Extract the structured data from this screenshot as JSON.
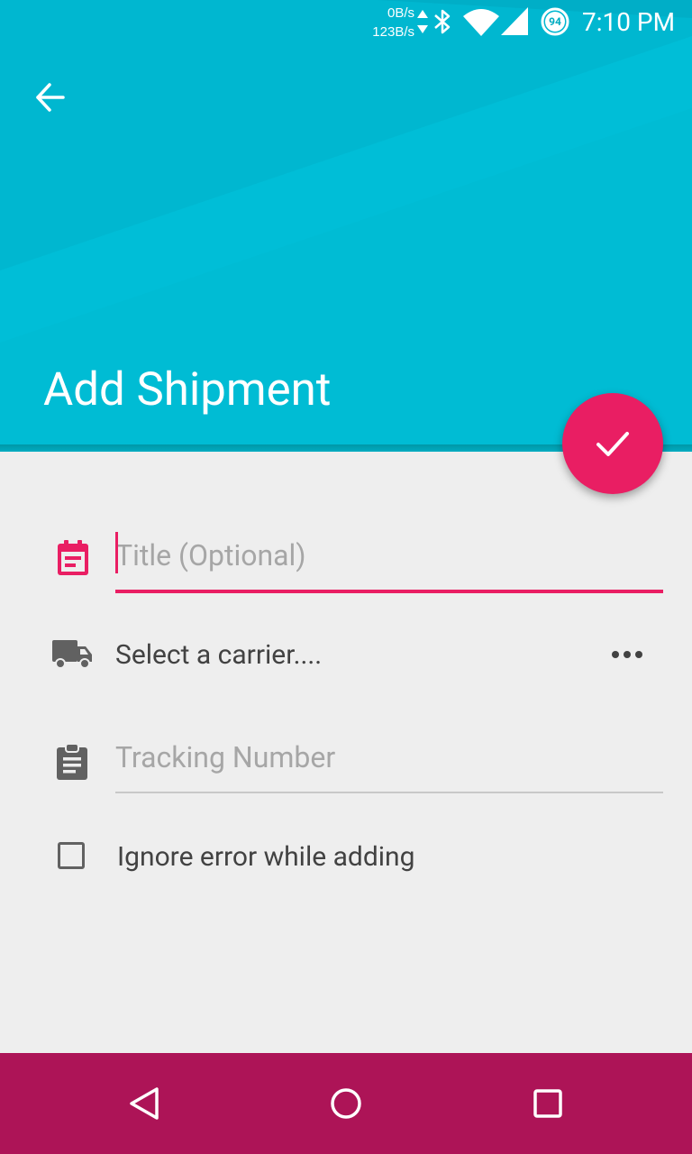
{
  "status_bar": {
    "net_down": "0B/s",
    "net_up": "123B/s",
    "battery_level": "94",
    "time": "7:10 PM"
  },
  "header": {
    "title": "Add Shipment",
    "accent_color": "#00bcd4"
  },
  "form": {
    "title_field": {
      "placeholder": "Title (Optional)",
      "value": ""
    },
    "carrier": {
      "label": "Select a carrier...."
    },
    "tracking_field": {
      "placeholder": "Tracking Number",
      "value": ""
    },
    "ignore_error": {
      "label": "Ignore error while adding",
      "checked": false
    }
  },
  "colors": {
    "fab": "#e91e63",
    "nav_bar": "#ad1457",
    "background": "#eeeeee"
  },
  "icons": {
    "back": "arrow-left-icon",
    "fab": "check-icon",
    "title": "calendar-icon",
    "carrier": "truck-icon",
    "tracking": "clipboard-icon",
    "more": "more-horizontal-icon"
  }
}
